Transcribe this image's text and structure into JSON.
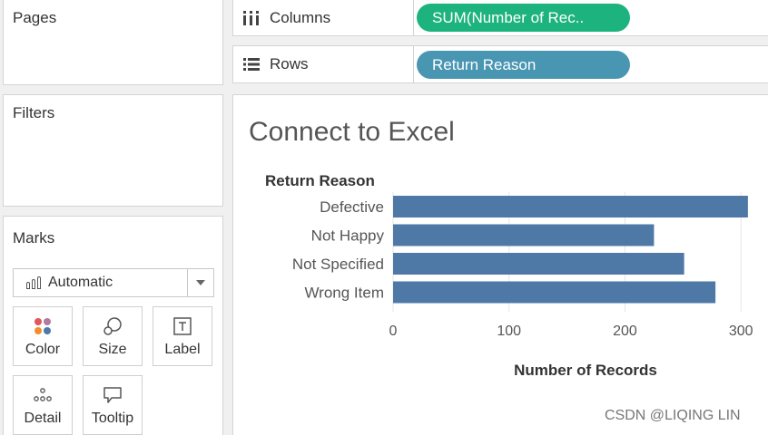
{
  "shelves": {
    "pages_title": "Pages",
    "filters_title": "Filters",
    "marks_title": "Marks",
    "columns": {
      "label": "Columns",
      "pill": "SUM(Number of Rec..",
      "pill_color": "#1db37e"
    },
    "rows": {
      "label": "Rows",
      "pill": "Return Reason",
      "pill_color": "#4996b2"
    }
  },
  "marks": {
    "type_label": "Automatic",
    "buttons": [
      {
        "label": "Color",
        "icon": "color-dots-icon"
      },
      {
        "label": "Size",
        "icon": "size-icon"
      },
      {
        "label": "Label",
        "icon": "label-icon"
      },
      {
        "label": "Detail",
        "icon": "detail-dots-icon"
      },
      {
        "label": "Tooltip",
        "icon": "tooltip-icon"
      }
    ]
  },
  "view": {
    "title": "Connect to Excel"
  },
  "chart_data": {
    "type": "bar",
    "orientation": "horizontal",
    "row_header": "Return Reason",
    "categories": [
      "Defective",
      "Not Happy",
      "Not Specified",
      "Wrong Item"
    ],
    "values": [
      306,
      225,
      251,
      278
    ],
    "xlabel": "Number of Records",
    "xticks": [
      "0",
      "100",
      "200",
      "300"
    ],
    "xlim": [
      0,
      310
    ],
    "bar_color": "#4e79a7",
    "grid": true
  },
  "watermark": "CSDN @LIQING LIN"
}
